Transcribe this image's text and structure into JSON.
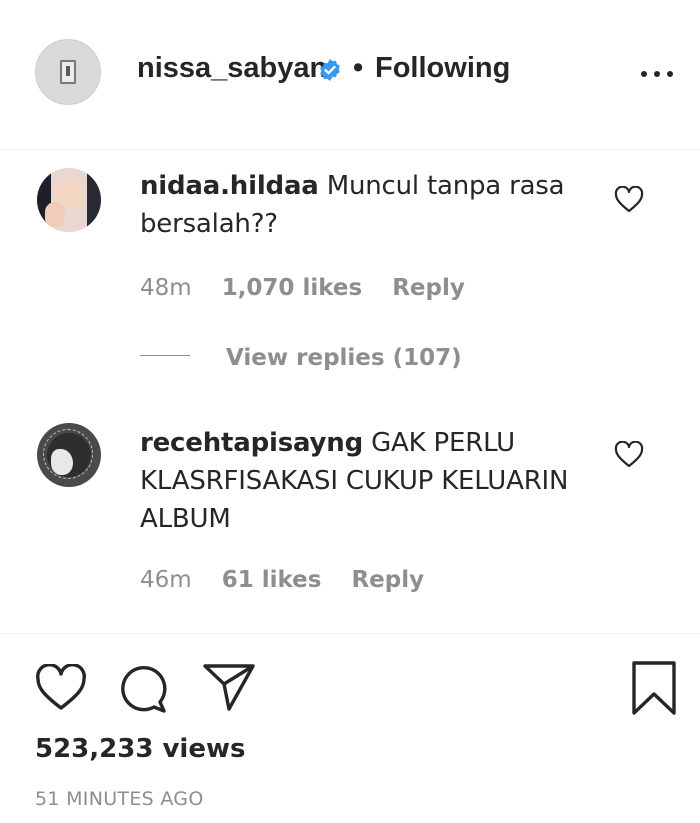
{
  "header": {
    "username": "nissa_sabyan",
    "separator": "•",
    "follow_status": "Following",
    "verified_icon": "verified-badge-icon",
    "more_icon": "more-options-icon"
  },
  "comments": [
    {
      "username": "nidaa.hildaa",
      "text": "Muncul tanpa rasa bersalah??",
      "time": "48m",
      "likes": "1,070 likes",
      "reply_label": "Reply",
      "view_replies": "View replies (107)"
    },
    {
      "username": "recehtapisayng",
      "text": "GAK PERLU KLASRFISAKASI CUKUP KELUARIN ALBUM",
      "time": "46m",
      "likes": "61 likes",
      "reply_label": "Reply"
    }
  ],
  "actions": {
    "like_icon": "heart-icon",
    "comment_icon": "comment-icon",
    "share_icon": "share-icon",
    "save_icon": "bookmark-icon"
  },
  "stats": {
    "views": "523,233 views",
    "timestamp": "51 MINUTES AGO"
  },
  "colors": {
    "text": "#262626",
    "muted": "#8e8e8e",
    "verified": "#3897f0",
    "divider": "#efefef"
  }
}
